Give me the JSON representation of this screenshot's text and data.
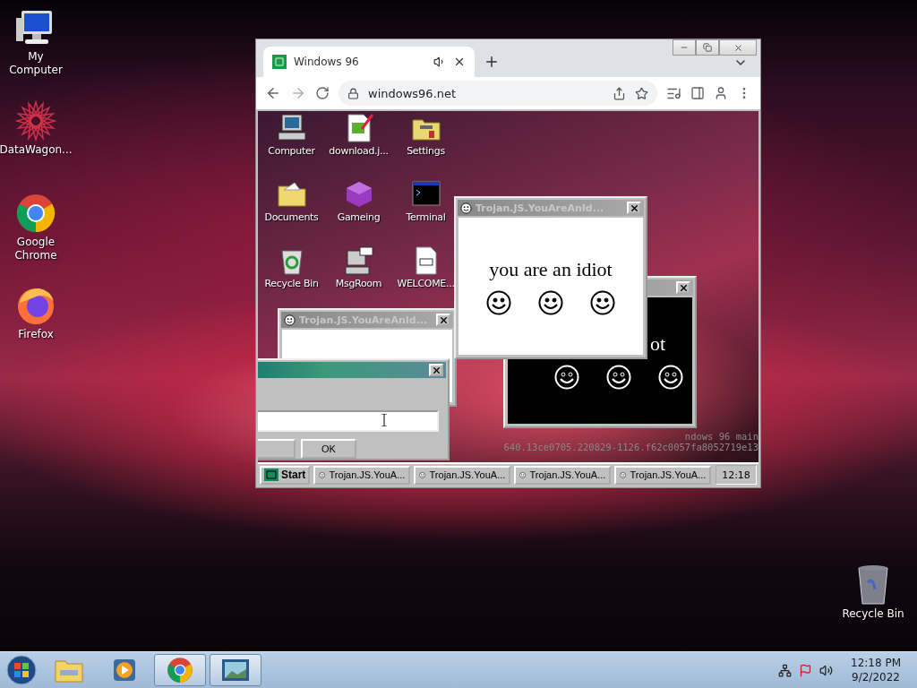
{
  "desktop_icons": [
    {
      "label": "My Computer",
      "kind": "computer"
    },
    {
      "label": "DataWagon...",
      "kind": "star"
    },
    {
      "label": "Google Chrome",
      "kind": "chrome"
    },
    {
      "label": "Firefox",
      "kind": "firefox"
    }
  ],
  "recycle_bin": {
    "label": "Recycle Bin"
  },
  "browser": {
    "tab": {
      "title": "Windows 96"
    },
    "address": "windows96.net"
  },
  "w96": {
    "icons": [
      {
        "label": "Computer",
        "kind": "computer"
      },
      {
        "label": "download.j...",
        "kind": "image"
      },
      {
        "label": "Settings",
        "kind": "settings"
      },
      {
        "label": "Documents",
        "kind": "folder"
      },
      {
        "label": "Gameing",
        "kind": "cube"
      },
      {
        "label": "Terminal",
        "kind": "terminal"
      },
      {
        "label": "Recycle Bin",
        "kind": "recycle"
      },
      {
        "label": "MsgRoom",
        "kind": "chat"
      },
      {
        "label": "WELCOME...",
        "kind": "markdown"
      }
    ],
    "popups": [
      {
        "kind": "white",
        "title": "Trojan.JS.YouAreAnId..."
      },
      {
        "kind": "dialog",
        "text": "OK"
      },
      {
        "kind": "black",
        "text": "ot"
      },
      {
        "kind": "white",
        "title": "Trojan.JS.YouAreAnId...",
        "text": "you are an idiot"
      }
    ],
    "console_lines": [
      "ndows 96 main",
      "640.13ce0705.220829-1126.f62c0057fa8052719e13"
    ],
    "taskbar": {
      "start": "Start",
      "tasks": [
        "Trojan.JS.YouA...",
        "Trojan.JS.YouA...",
        "Trojan.JS.YouA...",
        "Trojan.JS.YouA..."
      ],
      "clock": "12:18"
    }
  },
  "taskbar": {
    "pinned": [
      {
        "kind": "explorer",
        "running": false
      },
      {
        "kind": "media",
        "running": false
      },
      {
        "kind": "chrome",
        "running": true
      },
      {
        "kind": "photos",
        "running": true
      }
    ],
    "time": "12:18 PM",
    "date": "9/2/2022"
  }
}
